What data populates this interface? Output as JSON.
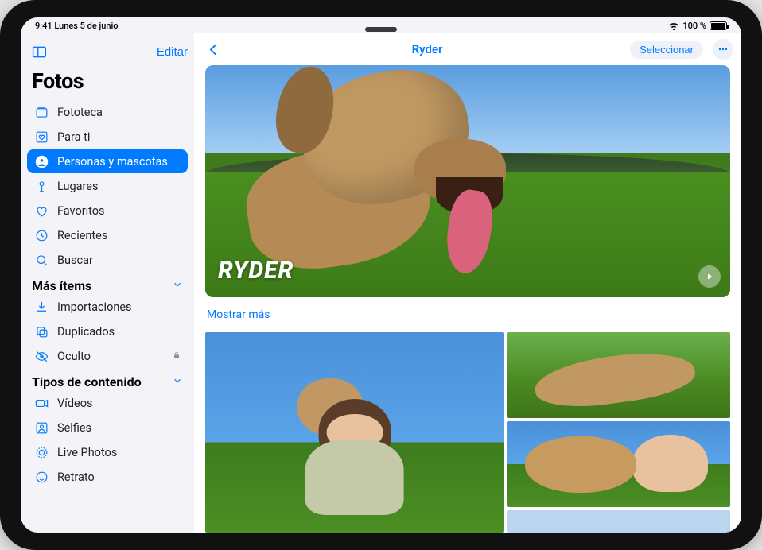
{
  "status": {
    "time_date": "9:41  Lunes 5 de junio",
    "battery_pct": "100 %"
  },
  "sidebar": {
    "edit": "Editar",
    "app_title": "Fotos",
    "items": [
      {
        "label": "Fototeca",
        "icon": "photo-stack"
      },
      {
        "label": "Para ti",
        "icon": "heart-square"
      },
      {
        "label": "Personas y mascotas",
        "icon": "person-circle",
        "selected": true
      },
      {
        "label": "Lugares",
        "icon": "pin"
      },
      {
        "label": "Favoritos",
        "icon": "heart"
      },
      {
        "label": "Recientes",
        "icon": "clock"
      },
      {
        "label": "Buscar",
        "icon": "search"
      }
    ],
    "section_more": {
      "title": "Más ítems",
      "items": [
        {
          "label": "Importaciones",
          "icon": "download"
        },
        {
          "label": "Duplicados",
          "icon": "duplicate"
        },
        {
          "label": "Oculto",
          "icon": "eye-off",
          "locked": true
        }
      ]
    },
    "section_types": {
      "title": "Tipos de contenido",
      "items": [
        {
          "label": "Vídeos",
          "icon": "video"
        },
        {
          "label": "Selfies",
          "icon": "selfie"
        },
        {
          "label": "Live Photos",
          "icon": "live-photo"
        },
        {
          "label": "Retrato",
          "icon": "portrait"
        }
      ]
    }
  },
  "main": {
    "title": "Ryder",
    "select": "Seleccionar",
    "hero_name": "RYDER",
    "show_more": "Mostrar más"
  }
}
